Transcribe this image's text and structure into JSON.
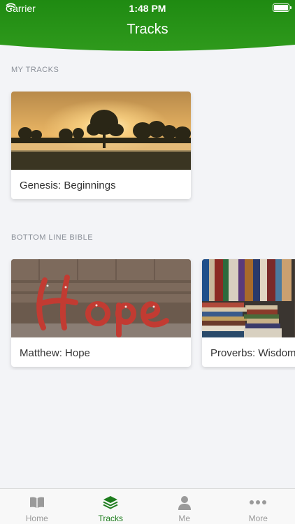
{
  "status": {
    "carrier": "Carrier",
    "time": "1:48 PM"
  },
  "header": {
    "title": "Tracks"
  },
  "sections": {
    "my_tracks": {
      "label": "MY TRACKS",
      "cards": [
        {
          "title": "Genesis: Beginnings"
        }
      ]
    },
    "bottom_line": {
      "label": "BOTTOM LINE BIBLE",
      "cards": [
        {
          "title": "Matthew: Hope"
        },
        {
          "title": "Proverbs: Wisdom"
        }
      ]
    }
  },
  "tabs": [
    {
      "label": "Home",
      "icon": "book-icon"
    },
    {
      "label": "Tracks",
      "icon": "layers-icon"
    },
    {
      "label": "Me",
      "icon": "person-icon"
    },
    {
      "label": "More",
      "icon": "ellipsis-icon"
    }
  ],
  "colors": {
    "brand_green": "#238a17",
    "active_tab": "#1e7d1e"
  }
}
